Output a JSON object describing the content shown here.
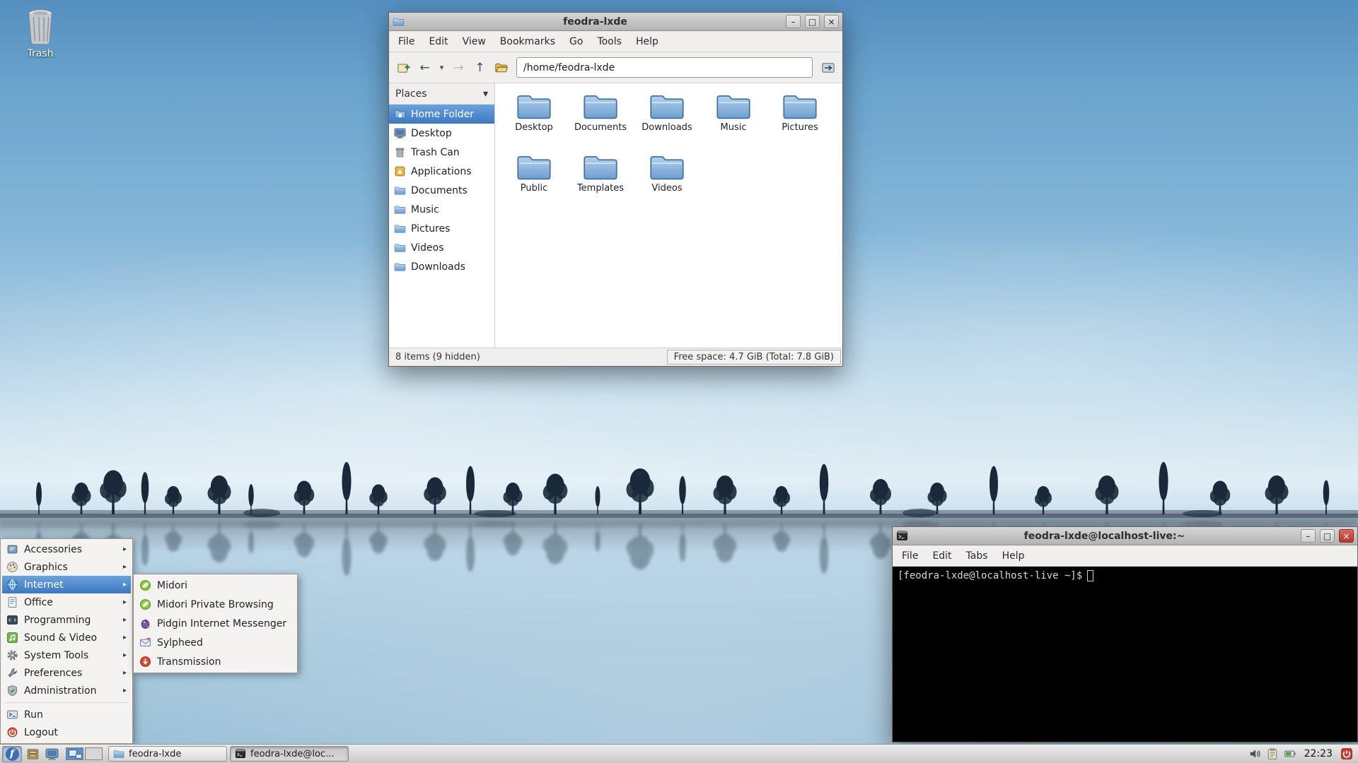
{
  "colors": {
    "selection_accent": "#3e79c0",
    "titlebar_gray": "#c2c2c2",
    "menu_bg": "#f4f3f1",
    "terminal_bg": "#000000",
    "terminal_fg": "#d8d8d8",
    "taskbar_bg": "#d9d9d9",
    "fedora_blue": "#3c6eb4",
    "folder_blue": "#78a8d6"
  },
  "glyphs": {
    "minimize": "–",
    "maximize": "□",
    "close": "×",
    "back": "←",
    "forward": "→",
    "up": "↑",
    "dropdown": "▾",
    "submenu_arrow": "▸"
  },
  "desktop": {
    "trash_label": "Trash"
  },
  "file_manager": {
    "title": "feodra-lxde",
    "menu": [
      "File",
      "Edit",
      "View",
      "Bookmarks",
      "Go",
      "Tools",
      "Help"
    ],
    "path": "/home/feodra-lxde",
    "places_header": "Places",
    "places": [
      {
        "label": "Home Folder"
      },
      {
        "label": "Desktop"
      },
      {
        "label": "Trash Can"
      },
      {
        "label": "Applications"
      },
      {
        "label": "Documents"
      },
      {
        "label": "Music"
      },
      {
        "label": "Pictures"
      },
      {
        "label": "Videos"
      },
      {
        "label": "Downloads"
      }
    ],
    "selected_place": "Home Folder",
    "folders": [
      "Desktop",
      "Documents",
      "Downloads",
      "Music",
      "Pictures",
      "Public",
      "Templates",
      "Videos"
    ],
    "status_items": "8 items (9 hidden)",
    "status_free": "Free space: 4.7 GiB (Total: 7.8 GiB)"
  },
  "terminal": {
    "title": "feodra-lxde@localhost-live:~",
    "menu": [
      "File",
      "Edit",
      "Tabs",
      "Help"
    ],
    "prompt": "[feodra-lxde@localhost-live ~]$"
  },
  "app_menu": {
    "categories": [
      {
        "label": "Accessories"
      },
      {
        "label": "Graphics"
      },
      {
        "label": "Internet"
      },
      {
        "label": "Office"
      },
      {
        "label": "Programming"
      },
      {
        "label": "Sound & Video"
      },
      {
        "label": "System Tools"
      },
      {
        "label": "Preferences"
      },
      {
        "label": "Administration"
      }
    ],
    "selected_category": "Internet",
    "actions": [
      {
        "label": "Run"
      },
      {
        "label": "Logout"
      }
    ],
    "submenu": [
      "Midori",
      "Midori Private Browsing",
      "Pidgin Internet Messenger",
      "Sylpheed",
      "Transmission"
    ]
  },
  "taskbar": {
    "tasks": [
      "feodra-lxde",
      "feodra-lxde@loc..."
    ],
    "clock": "22:23"
  }
}
